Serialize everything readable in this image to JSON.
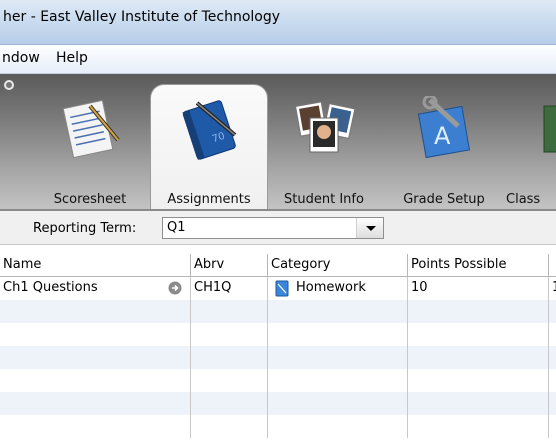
{
  "window": {
    "title": "her - East Valley Institute of Technology"
  },
  "menu": {
    "items": [
      "ndow",
      "Help"
    ]
  },
  "tabs": [
    {
      "label": "Scoresheet",
      "icon": "scoresheet-icon"
    },
    {
      "label": "Assignments",
      "icon": "assignments-notebook-icon",
      "selected": true
    },
    {
      "label": "Student Info",
      "icon": "student-photos-icon"
    },
    {
      "label": "Grade Setup",
      "icon": "grade-setup-tools-icon"
    },
    {
      "label": "Class",
      "icon": "class-icon"
    }
  ],
  "reporting_term": {
    "label": "Reporting Term:",
    "value": "Q1"
  },
  "grid": {
    "columns": [
      "Name",
      "Abrv",
      "Category",
      "Points Possible"
    ],
    "rows": [
      {
        "name": "Ch1 Questions",
        "abrv": "CH1Q",
        "category": "Homework",
        "points": "10",
        "extra": "1"
      }
    ]
  },
  "colors": {
    "toolbar_dark": "#5a5a5a",
    "alt_row": "#eef3fa",
    "titlebar": "#c9dbef"
  }
}
